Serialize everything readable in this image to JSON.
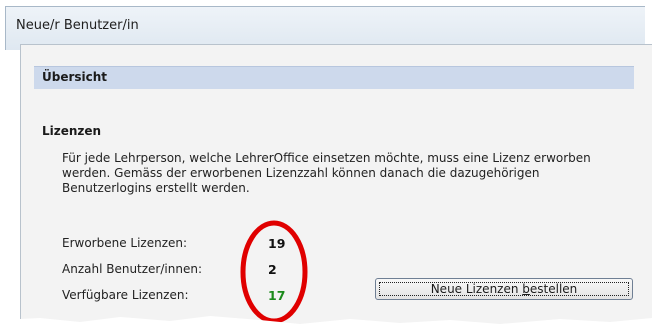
{
  "window": {
    "title": "Neue/r Benutzer/in"
  },
  "overview": {
    "title": "Übersicht"
  },
  "licenses": {
    "section_title": "Lizenzen",
    "description": "Für jede Lehrperson, welche LehrerOffice einsetzen möchte, muss eine Lizenz erworben werden. Gemäss der erworbenen Lizenzzahl können danach die dazugehörigen Benutzerlogins erstellt werden.",
    "rows": [
      {
        "label": "Erworbene Lizenzen:",
        "value": "19"
      },
      {
        "label": "Anzahl Benutzer/innen:",
        "value": "2"
      },
      {
        "label": "Verfügbare Lizenzen:",
        "value": "17"
      }
    ],
    "order_button": {
      "prefix": "Neue Lizenzen ",
      "accel": "b",
      "suffix": "estellen"
    }
  },
  "colors": {
    "highlight_circle": "#e00000",
    "available_value": "#1c8a1c",
    "overview_band": "#cdd9ec"
  }
}
